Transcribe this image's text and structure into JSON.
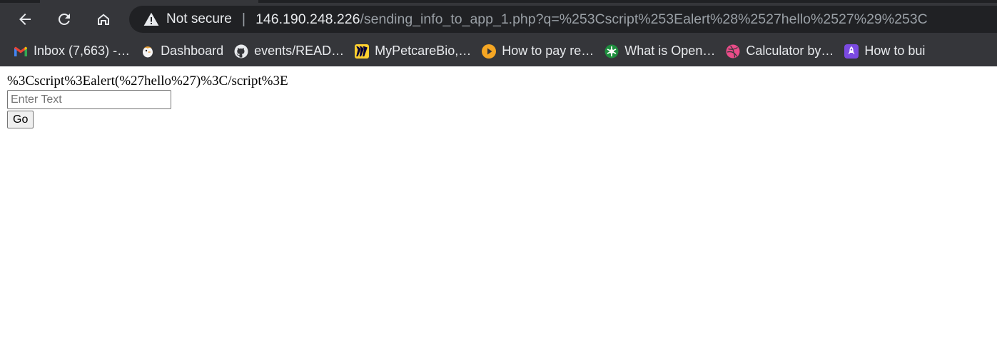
{
  "toolbar": {
    "back_icon": "arrow-left-icon",
    "reload_icon": "reload-icon",
    "home_icon": "home-icon"
  },
  "omnibox": {
    "security_label": "Not secure",
    "separator": "|",
    "url_host": "146.190.248.226",
    "url_rest": "/sending_info_to_app_1.php?q=%253Cscript%253Ealert%28%2527hello%2527%29%253C",
    "warning_color": "#e8eaed"
  },
  "bookmarks": [
    {
      "label": "Inbox (7,663) -…",
      "icon": "gmail-icon"
    },
    {
      "label": "Dashboard",
      "icon": "dashboard-bird-icon"
    },
    {
      "label": "events/READ…",
      "icon": "github-icon"
    },
    {
      "label": "MyPetcareBio,…",
      "icon": "miro-icon"
    },
    {
      "label": "How to pay re…",
      "icon": "play-circle-icon"
    },
    {
      "label": "What is Open…",
      "icon": "openai-leaf-icon"
    },
    {
      "label": "Calculator by…",
      "icon": "dribbble-icon"
    },
    {
      "label": "How to bui",
      "icon": "rocket-icon"
    }
  ],
  "page": {
    "output_text": "%3Cscript%3Ealert(%27hello%27)%3C/script%3E",
    "input_placeholder": "Enter Text",
    "input_value": "",
    "go_label": "Go"
  }
}
